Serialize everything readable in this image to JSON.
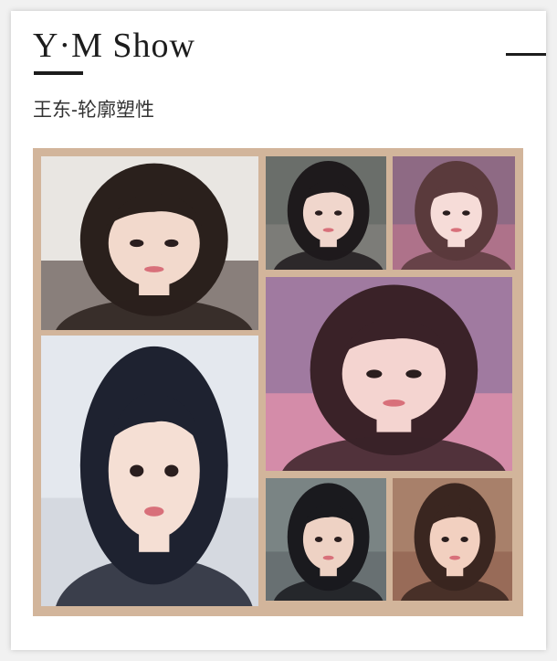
{
  "header": {
    "title": "Y·M Show",
    "subtitle": "王东-轮廓塑性"
  },
  "collage": {
    "frame_color": "#d2b59b",
    "photos": [
      {
        "name": "photo-cap-portrait",
        "background": "#e9e6e2",
        "hair": "#2a201c",
        "skin": "#f2d9cc",
        "accent": "#3b2a26"
      },
      {
        "name": "photo-long-hair-profile",
        "background": "#e4e8ee",
        "hair": "#1e2230",
        "skin": "#f5dfd4",
        "accent": "#c8ccd6"
      },
      {
        "name": "photo-selfie-1",
        "background": "#6a6e6a",
        "hair": "#1e1a1c",
        "skin": "#f0d6cc",
        "accent": "#8a8884"
      },
      {
        "name": "photo-selfie-2",
        "background": "#8e6a84",
        "hair": "#5a3a3c",
        "skin": "#f6dcd8",
        "accent": "#c87890"
      },
      {
        "name": "photo-filter-selfie",
        "background": "#a07aa0",
        "hair": "#3a2228",
        "skin": "#f4d4d0",
        "accent": "#ff9ab0"
      },
      {
        "name": "photo-selfie-3",
        "background": "#7a8484",
        "hair": "#1a1a1e",
        "skin": "#eed2c4",
        "accent": "#5a6064"
      },
      {
        "name": "photo-selfie-4",
        "background": "#a8806a",
        "hair": "#3a2620",
        "skin": "#f2d0c0",
        "accent": "#8a5a48"
      }
    ]
  }
}
